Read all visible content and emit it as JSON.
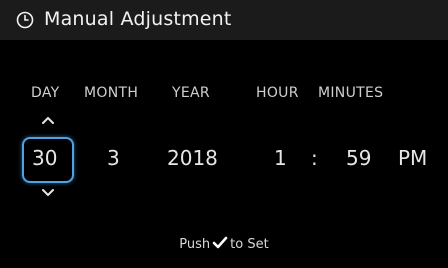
{
  "header": {
    "title": "Manual Adjustment",
    "icon": "clock-icon"
  },
  "columns": {
    "day": "DAY",
    "month": "MONTH",
    "year": "YEAR",
    "hour": "HOUR",
    "minutes": "MINUTES"
  },
  "values": {
    "day": "30",
    "month": "3",
    "year": "2018",
    "hour": "1",
    "separator": ":",
    "minutes": "59",
    "ampm": "PM"
  },
  "footer": {
    "prefix": "Push",
    "suffix": "to Set",
    "icon": "checkmark-icon"
  },
  "colors": {
    "accent": "#4ea3e6",
    "header_bg": "#1b1b1b",
    "background": "#000000"
  }
}
